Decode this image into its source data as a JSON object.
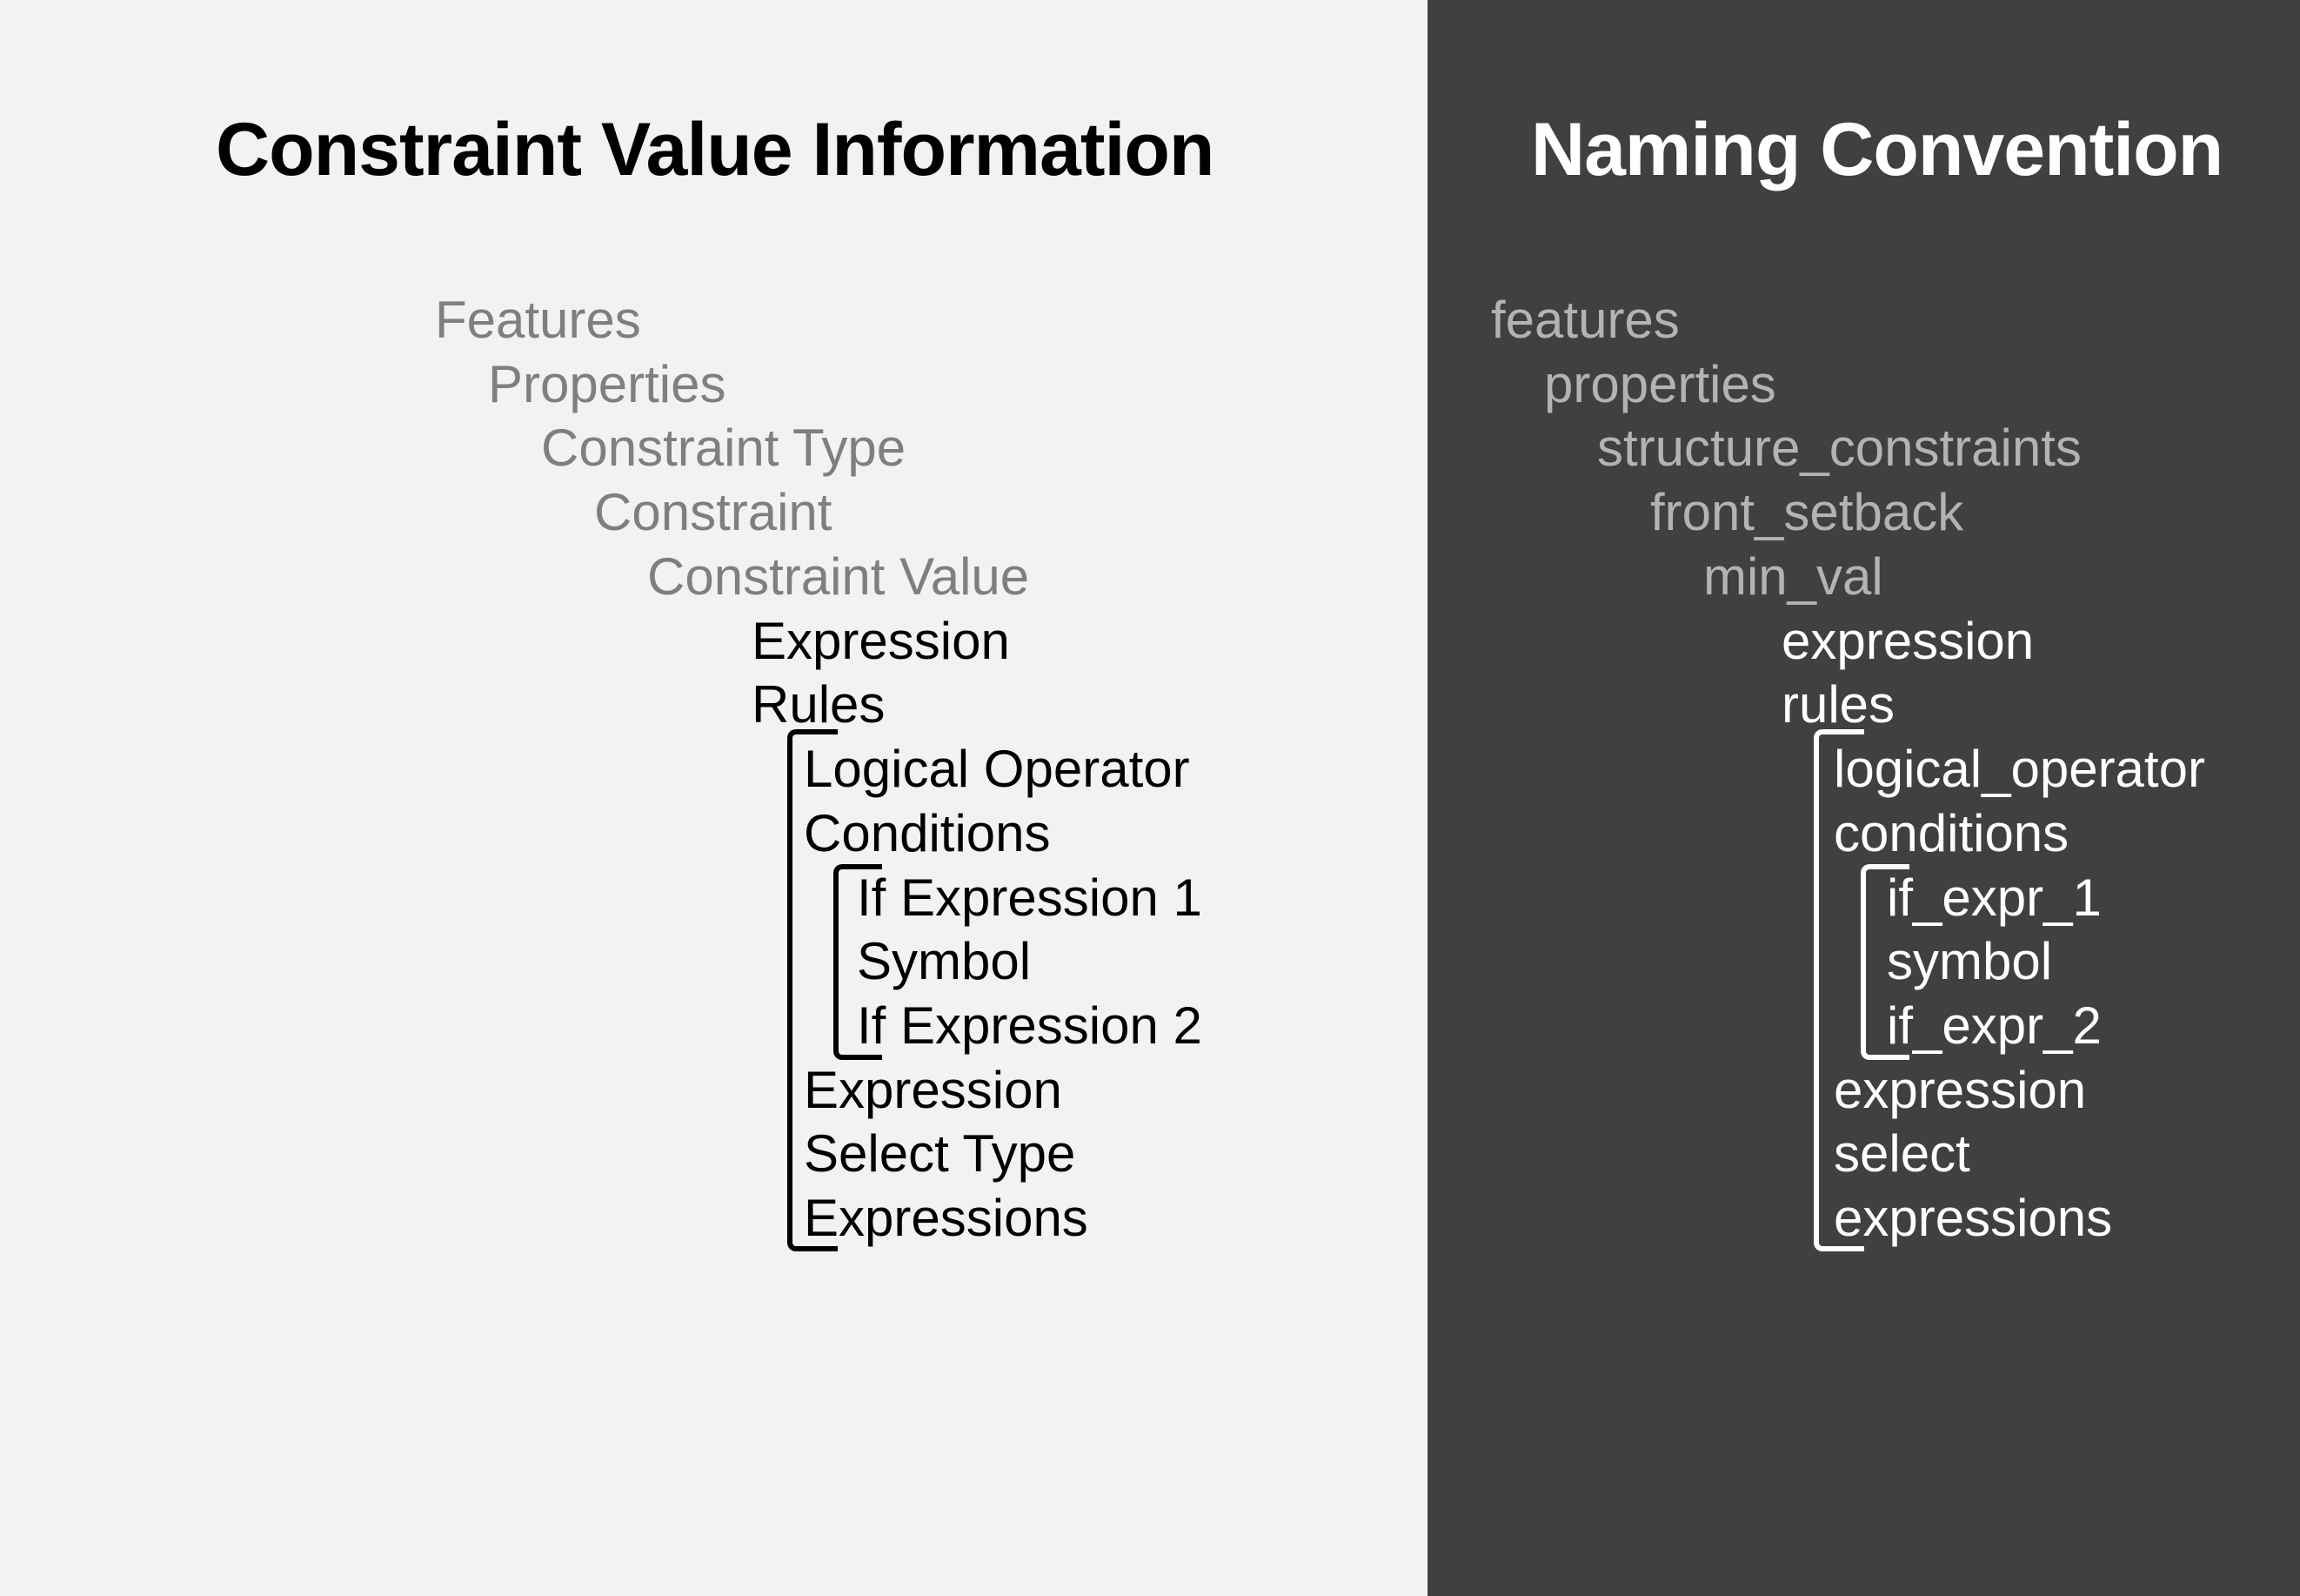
{
  "left": {
    "title": "Constraint Value Information",
    "rows": [
      "Features",
      "Properties",
      "Constraint Type",
      "Constraint",
      "Constraint Value",
      "Expression",
      "Rules",
      "Logical Operator",
      "Conditions",
      "If Expression 1",
      "Symbol",
      "If Expression 2",
      "Expression",
      "Select Type",
      "Expressions"
    ]
  },
  "right": {
    "title": "Naming Convention",
    "rows": [
      "features",
      "properties",
      "structure_constraints",
      "front_setback",
      "min_val",
      "expression",
      "rules",
      "logical_operator",
      "conditions",
      "if_expr_1",
      "symbol",
      "if_expr_2",
      "expression",
      "select",
      "expressions"
    ]
  },
  "colors": {
    "left_background": "#f2f2f2",
    "right_background": "#404040",
    "muted_text_left": "#7f7f7f",
    "muted_text_right": "#b3b3b3"
  }
}
